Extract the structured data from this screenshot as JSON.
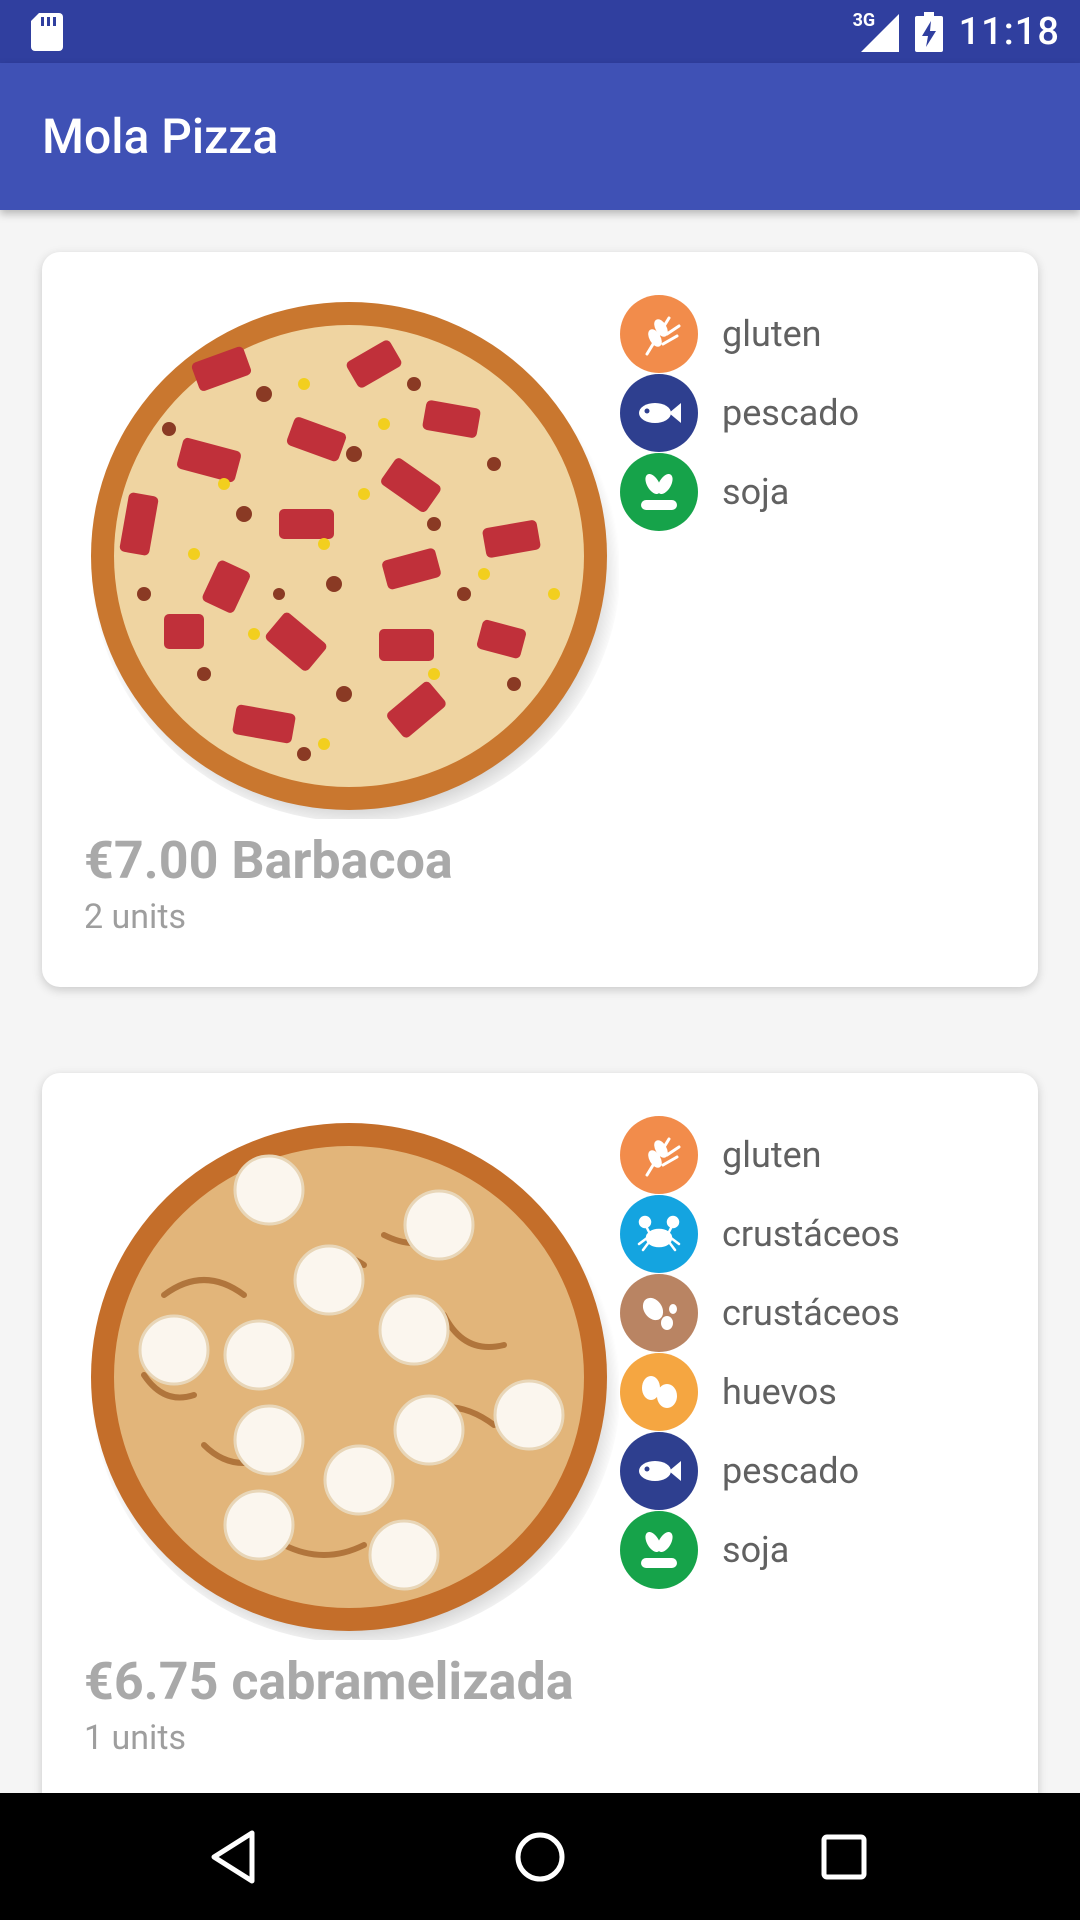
{
  "status_bar": {
    "network_type": "3G",
    "time": "11:18",
    "left_icon": "sd-card-icon",
    "signal_icon": "signal-icon",
    "battery_icon": "battery-charging-icon",
    "color": "#303f9f"
  },
  "app_bar": {
    "title": "Mola Pizza",
    "color": "#3f51b5"
  },
  "pizzas": [
    {
      "price_title": "€7.00 Barbacoa",
      "units": "2  units",
      "image": "pizza-barbacoa-image",
      "allergens": [
        {
          "label": "gluten",
          "icon": "wheat-icon",
          "color": "#f28c4b"
        },
        {
          "label": "pescado",
          "icon": "fish-icon",
          "color": "#2e3f8f"
        },
        {
          "label": "soja",
          "icon": "soy-icon",
          "color": "#16a34a"
        }
      ]
    },
    {
      "price_title": "€6.75 cabramelizada",
      "units": "1  units",
      "image": "pizza-cabramelizada-image",
      "allergens": [
        {
          "label": "gluten",
          "icon": "wheat-icon",
          "color": "#f28c4b"
        },
        {
          "label": "crustáceos",
          "icon": "crab-icon",
          "color": "#14a4e0"
        },
        {
          "label": "crustáceos",
          "icon": "peanut-icon",
          "color": "#b98463"
        },
        {
          "label": "huevos",
          "icon": "eggs-icon",
          "color": "#f5a641"
        },
        {
          "label": "pescado",
          "icon": "fish-icon",
          "color": "#2e3f8f"
        },
        {
          "label": "soja",
          "icon": "soy-icon",
          "color": "#16a34a"
        }
      ]
    }
  ],
  "nav_bar": {
    "back_icon": "back-icon",
    "home_icon": "home-icon",
    "recents_icon": "recents-icon"
  }
}
